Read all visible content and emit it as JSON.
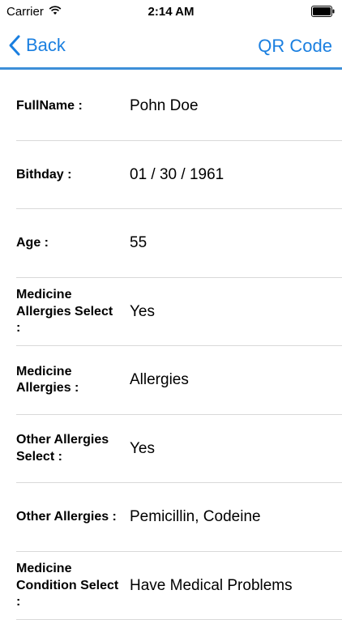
{
  "status_bar": {
    "carrier": "Carrier",
    "time": "2:14 AM",
    "battery_icon": "battery-icon",
    "wifi_icon": "wifi-icon"
  },
  "nav": {
    "back_label": "Back",
    "right_label": "QR Code",
    "accent_color": "#1a7fe0"
  },
  "fields": [
    {
      "label": "FullName :",
      "value": "Pohn Doe"
    },
    {
      "label": "Bithday :",
      "value": "01 / 30 / 1961"
    },
    {
      "label": "Age :",
      "value": "55"
    },
    {
      "label": "Medicine Allergies Select :",
      "value": "Yes"
    },
    {
      "label": "Medicine Allergies :",
      "value": "Allergies"
    },
    {
      "label": "Other Allergies Select :",
      "value": "Yes"
    },
    {
      "label": "Other Allergies :",
      "value": "Pemicillin, Codeine"
    },
    {
      "label": "Medicine Condition Select :",
      "value": "Have Medical Problems"
    }
  ]
}
